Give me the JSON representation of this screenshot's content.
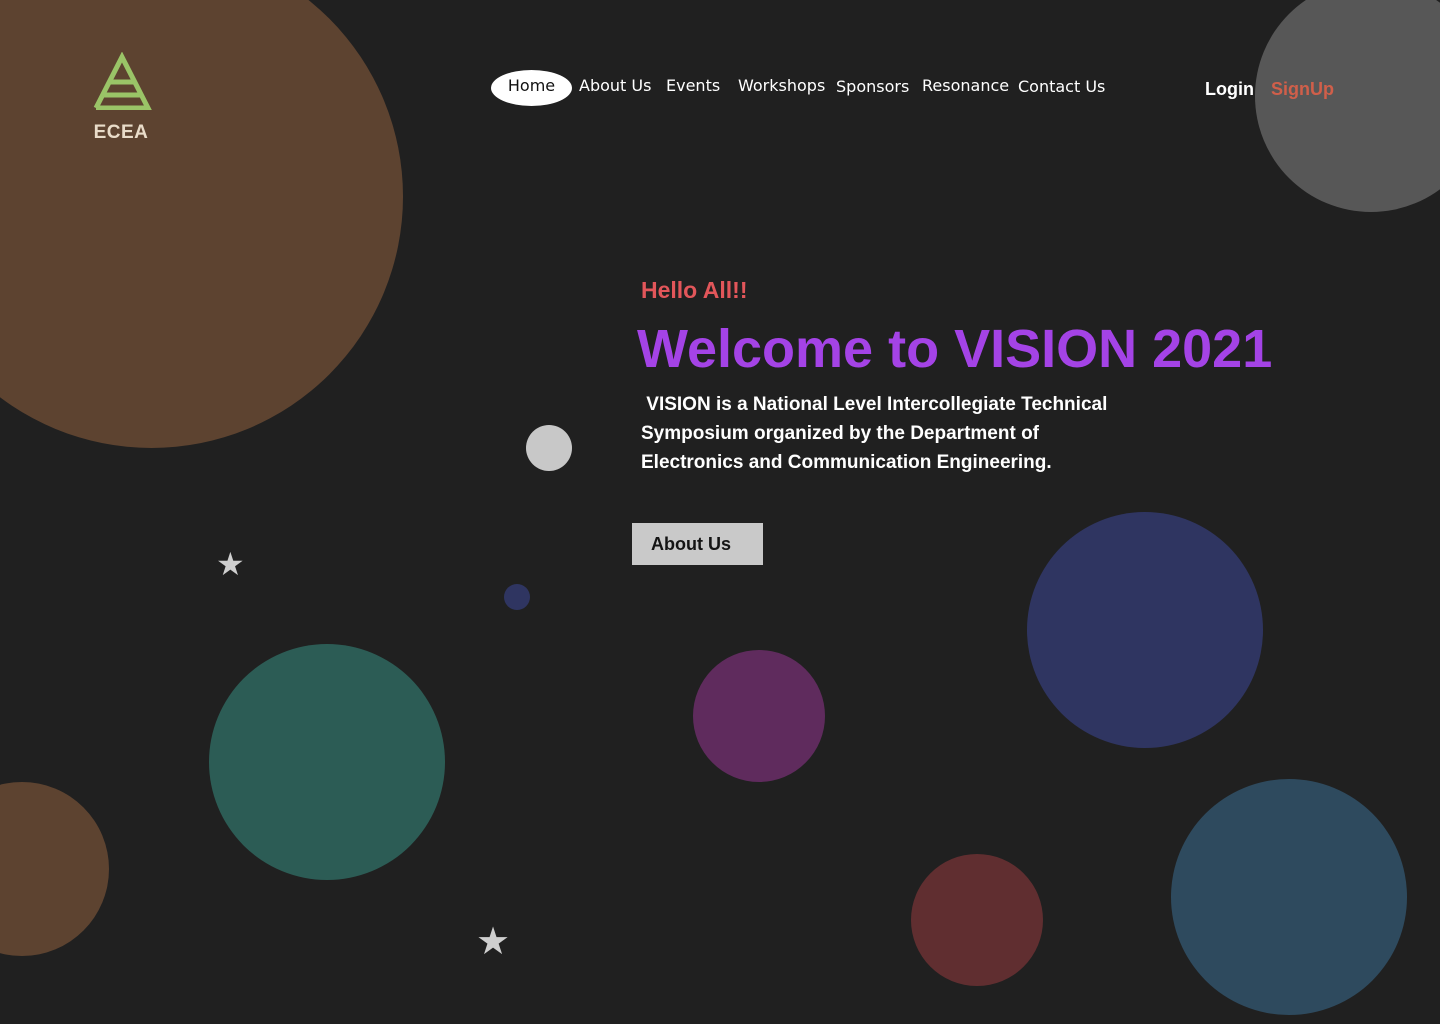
{
  "logo": {
    "text": "ECEA",
    "icon": "ecea-triangle-logo-icon",
    "color": "#9ac467"
  },
  "nav": {
    "items": [
      {
        "label": "Home",
        "active": true
      },
      {
        "label": "About Us"
      },
      {
        "label": "Events"
      },
      {
        "label": "Workshops"
      },
      {
        "label": "Sponsors"
      },
      {
        "label": "Resonance"
      },
      {
        "label": "Contact Us"
      }
    ]
  },
  "auth": {
    "login": "Login",
    "signup": "SignUp"
  },
  "hero": {
    "greeting": "Hello All!!",
    "title": "Welcome to VISION 2021",
    "description": " VISION is a National Level Intercollegiate Technical Symposium organized by the Department of Electronics and Communication Engineering.",
    "button": "About Us"
  },
  "colors": {
    "background": "#202020",
    "title": "#a443e6",
    "greeting": "#e2565a",
    "signup": "#d05f4a",
    "decor": [
      "#5d4330",
      "#575757",
      "#c8c8c8",
      "#2f3561",
      "#2c5c55",
      "#5f2b5d",
      "#602e30",
      "#2e4a5e"
    ]
  }
}
